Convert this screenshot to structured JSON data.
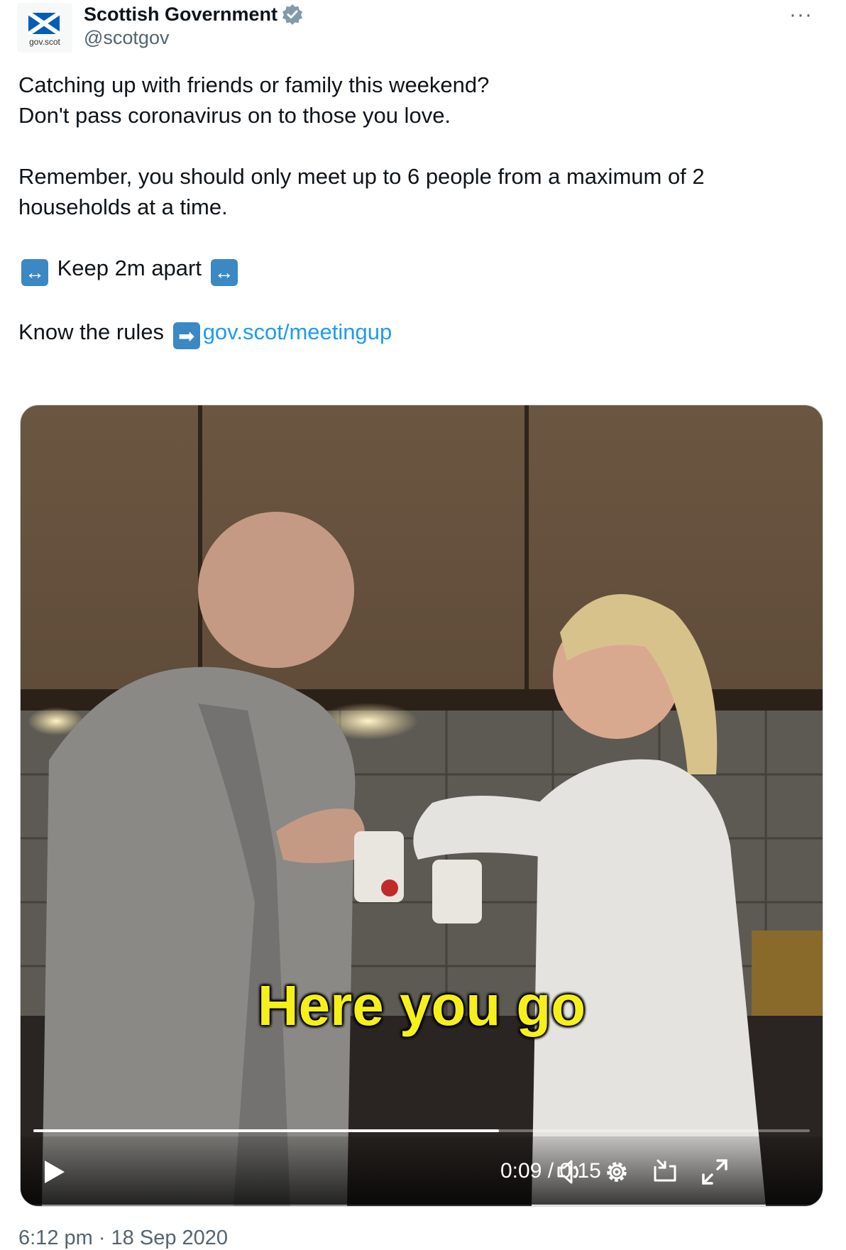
{
  "account": {
    "name": "Scottish Government",
    "handle": "@scotgov",
    "avatar_text": "gov.scot",
    "verified_icon": "verified-badge-icon",
    "more_glyph": "···"
  },
  "tweet": {
    "line1": "Catching up with friends or family this weekend?",
    "line2": "Don't pass coronavirus on to those you love.",
    "line3": "Remember, you should only meet up to 6 people from a maximum of 2",
    "line4": "households at a time.",
    "keep_apart": "Keep 2m apart",
    "know_rules": "Know the rules",
    "link": "gov.scot/meetingup",
    "emoji_left_right": "↔",
    "emoji_right_arrow": "➡"
  },
  "video": {
    "subtitle": "Here you go",
    "current_time": "0:09",
    "duration": "0:15",
    "time_display": "0:09 / 0:15",
    "progress_fraction": 0.6,
    "icons": [
      "play-icon",
      "volume-icon",
      "settings-icon",
      "dock-icon",
      "fullscreen-icon"
    ]
  },
  "meta": {
    "timestamp": "6:12 pm · 18 Sep 2020"
  },
  "colors": {
    "link": "#1d9bf0",
    "secondary_text": "#536471",
    "subtitle": "#f6f01a",
    "saltire": "#005eb8"
  }
}
